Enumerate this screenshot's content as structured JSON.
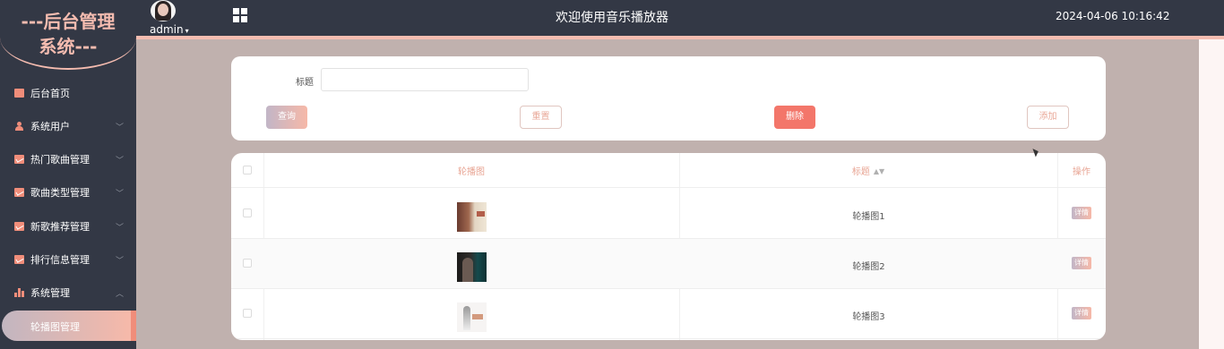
{
  "header": {
    "username": "admin",
    "title": "欢迎使用音乐播放器",
    "datetime": "2024-04-06 10:16:42"
  },
  "sidebar": {
    "logo_line1": "---后台管理",
    "logo_line2": "系统---",
    "items": [
      {
        "label": "后台首页",
        "icon": "monitor-icon"
      },
      {
        "label": "系统用户",
        "icon": "user-icon"
      },
      {
        "label": "热门歌曲管理",
        "icon": "chart-icon"
      },
      {
        "label": "歌曲类型管理",
        "icon": "chart-icon"
      },
      {
        "label": "新歌推荐管理",
        "icon": "chart-icon"
      },
      {
        "label": "排行信息管理",
        "icon": "chart-icon"
      },
      {
        "label": "系统管理",
        "icon": "bar-chart-icon"
      }
    ],
    "active_submenu": "轮播图管理"
  },
  "search": {
    "label": "标题",
    "value": "",
    "placeholder": "",
    "buttons": {
      "query": "查询",
      "reset": "重置",
      "delete": "删除",
      "add": "添加"
    }
  },
  "table": {
    "columns": [
      "轮播图",
      "标题",
      "操作"
    ],
    "rows": [
      {
        "title": "轮播图1",
        "action": "详情"
      },
      {
        "title": "轮播图2",
        "action": "详情"
      },
      {
        "title": "轮播图3",
        "action": "详情"
      }
    ]
  },
  "colors": {
    "sidebar_bg": "#333845",
    "accent": "#f5bcb0",
    "delete": "#f3766a",
    "content_bg": "#c0b1ae"
  }
}
